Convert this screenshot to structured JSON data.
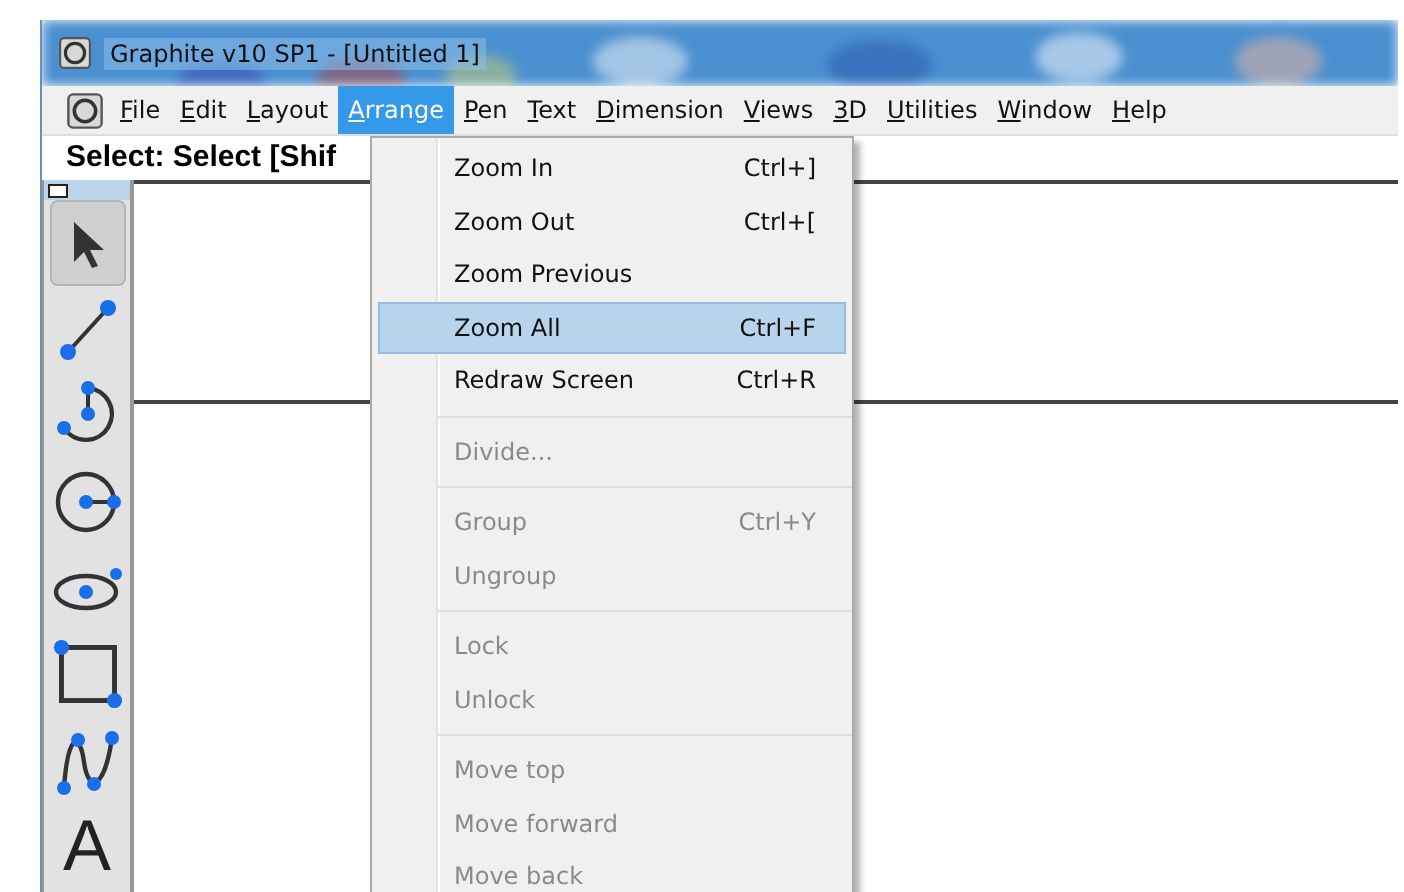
{
  "window": {
    "title": "Graphite v10 SP1 - [Untitled 1]"
  },
  "menu_bar": [
    {
      "label": "File",
      "selected": false
    },
    {
      "label": "Edit",
      "selected": false
    },
    {
      "label": "Layout",
      "selected": false
    },
    {
      "label": "Arrange",
      "selected": true
    },
    {
      "label": "Pen",
      "selected": false
    },
    {
      "label": "Text",
      "selected": false
    },
    {
      "label": "Dimension",
      "selected": false
    },
    {
      "label": "Views",
      "selected": false
    },
    {
      "label": "3D",
      "selected": false
    },
    {
      "label": "Utilities",
      "selected": false
    },
    {
      "label": "Window",
      "selected": false
    },
    {
      "label": "Help",
      "selected": false
    }
  ],
  "prompt": "Select: Select  [Shif",
  "tools": [
    {
      "kind": "arrow",
      "selected": true
    },
    {
      "kind": "line",
      "selected": false
    },
    {
      "kind": "arc",
      "selected": false
    },
    {
      "kind": "circle",
      "selected": false
    },
    {
      "kind": "ellipse",
      "selected": false
    },
    {
      "kind": "rectangle",
      "selected": false
    },
    {
      "kind": "spline",
      "selected": false
    },
    {
      "kind": "text",
      "glyph": "A",
      "selected": false
    }
  ],
  "dropdown": [
    {
      "kind": "item",
      "label": "Zoom In",
      "shortcut": "Ctrl+]",
      "disabled": false,
      "selected": false
    },
    {
      "kind": "item",
      "label": "Zoom Out",
      "shortcut": "Ctrl+[",
      "disabled": false,
      "selected": false
    },
    {
      "kind": "item",
      "label": "Zoom Previous",
      "disabled": false,
      "selected": false
    },
    {
      "kind": "item",
      "label": "Zoom All",
      "shortcut": "Ctrl+F",
      "disabled": false,
      "selected": true
    },
    {
      "kind": "item",
      "label": "Redraw Screen",
      "shortcut": "Ctrl+R",
      "disabled": false,
      "selected": false
    },
    {
      "kind": "separator"
    },
    {
      "kind": "item",
      "label": "Divide...",
      "disabled": true,
      "selected": false
    },
    {
      "kind": "separator"
    },
    {
      "kind": "item",
      "label": "Group",
      "shortcut": "Ctrl+Y",
      "disabled": true,
      "selected": false
    },
    {
      "kind": "item",
      "label": "Ungroup",
      "disabled": true,
      "selected": false
    },
    {
      "kind": "separator"
    },
    {
      "kind": "item",
      "label": "Lock",
      "disabled": true,
      "selected": false
    },
    {
      "kind": "item",
      "label": "Unlock",
      "disabled": true,
      "selected": false
    },
    {
      "kind": "separator"
    },
    {
      "kind": "item",
      "label": "Move top",
      "disabled": true,
      "selected": false
    },
    {
      "kind": "item",
      "label": "Move forward",
      "disabled": true,
      "selected": false
    },
    {
      "kind": "item",
      "label": "Move back",
      "disabled": true,
      "selected": false
    }
  ]
}
